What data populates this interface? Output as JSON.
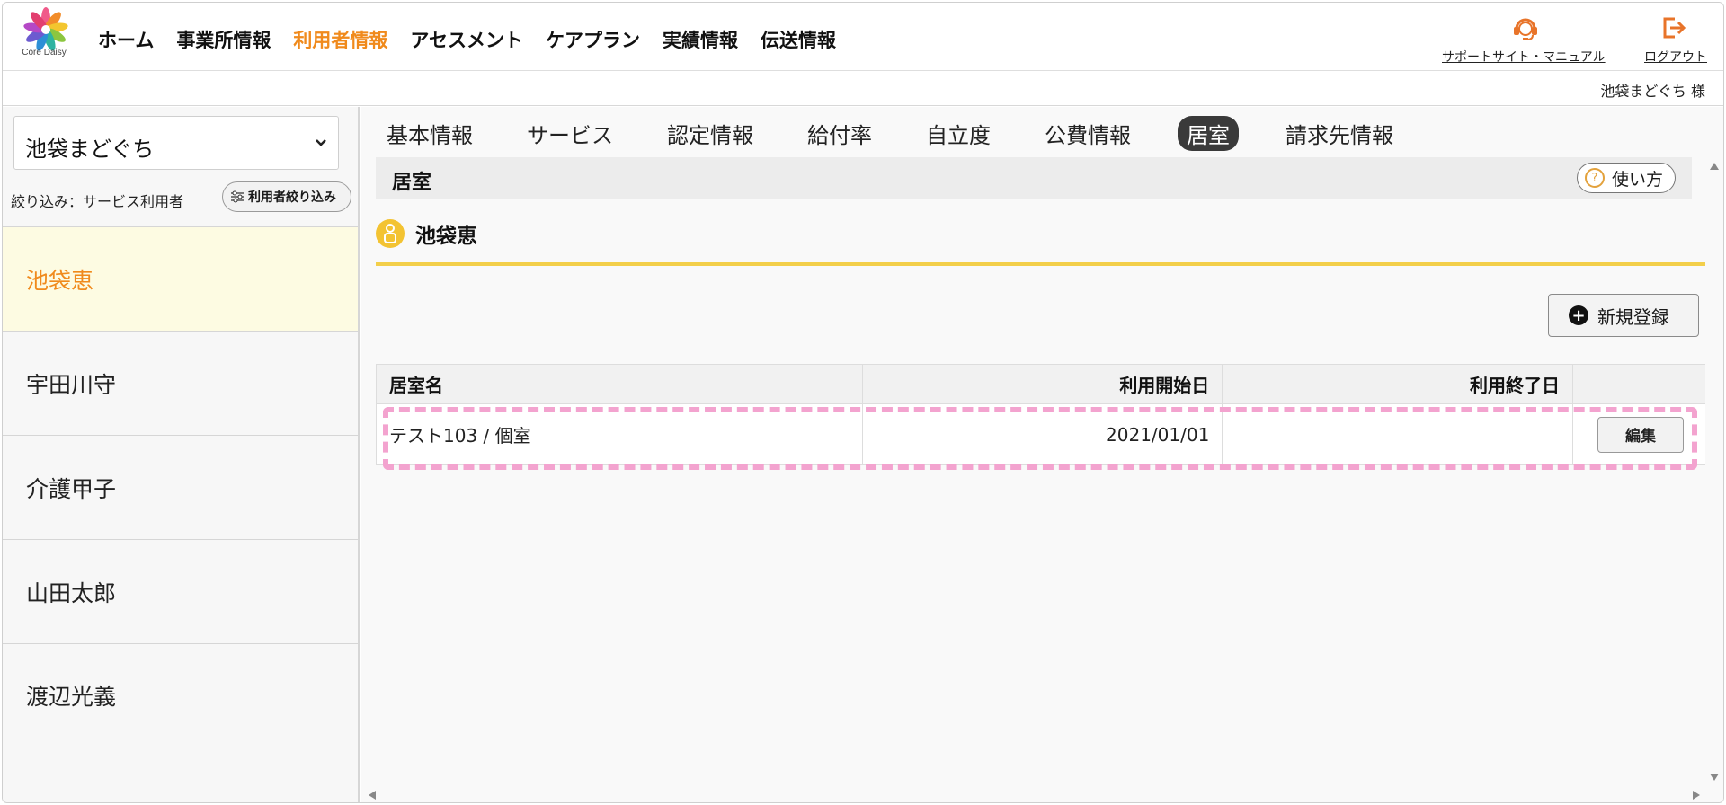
{
  "header": {
    "logo_text": "Core Daisy",
    "nav": [
      {
        "label": "ホーム",
        "active": false
      },
      {
        "label": "事業所情報",
        "active": false
      },
      {
        "label": "利用者情報",
        "active": true
      },
      {
        "label": "アセスメント",
        "active": false
      },
      {
        "label": "ケアプラン",
        "active": false
      },
      {
        "label": "実績情報",
        "active": false
      },
      {
        "label": "伝送情報",
        "active": false
      }
    ],
    "support_label": "サポートサイト・マニュアル",
    "logout_label": "ログアウト",
    "user_greeting": "池袋まどぐち 様",
    "accent_color": "#f08a1c"
  },
  "sidebar": {
    "office_select": "池袋まどぐち",
    "filter_label": "絞り込み：サービス利用者",
    "filter_button": "利用者絞り込み",
    "users": [
      {
        "name": "池袋恵",
        "selected": true
      },
      {
        "name": "宇田川守",
        "selected": false
      },
      {
        "name": "介護甲子",
        "selected": false
      },
      {
        "name": "山田太郎",
        "selected": false
      },
      {
        "name": "渡辺光義",
        "selected": false
      }
    ]
  },
  "main": {
    "tabs": [
      {
        "label": "基本情報",
        "active": false
      },
      {
        "label": "サービス",
        "active": false
      },
      {
        "label": "認定情報",
        "active": false
      },
      {
        "label": "給付率",
        "active": false
      },
      {
        "label": "自立度",
        "active": false
      },
      {
        "label": "公費情報",
        "active": false
      },
      {
        "label": "居室",
        "active": true
      },
      {
        "label": "請求先情報",
        "active": false
      }
    ],
    "section_title": "居室",
    "help_label": "使い方",
    "person_name": "池袋恵",
    "new_button": "新規登録",
    "table": {
      "headers": [
        "居室名",
        "利用開始日",
        "利用終了日",
        ""
      ],
      "rows": [
        {
          "room": "テスト103 / 個室",
          "start": "2021/01/01",
          "end": "",
          "action": "編集"
        }
      ]
    }
  }
}
